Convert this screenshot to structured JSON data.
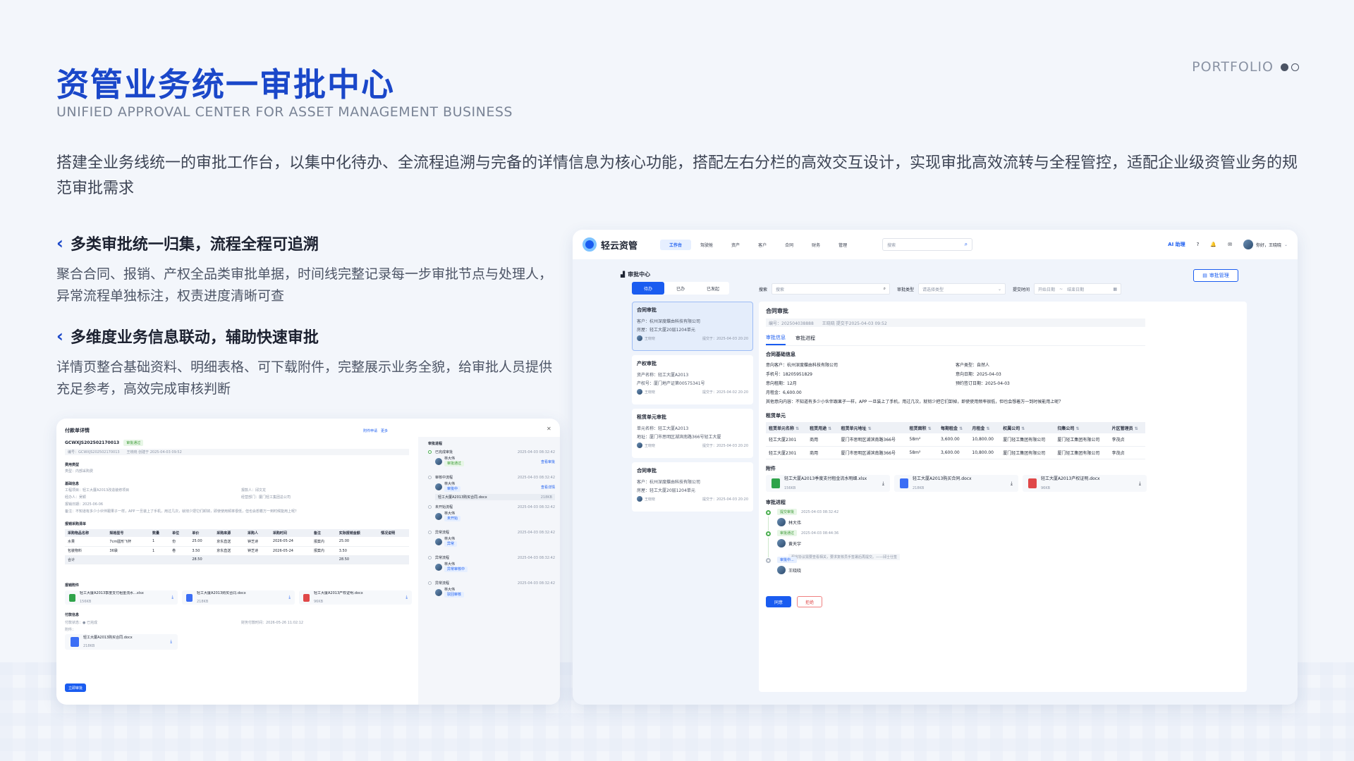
{
  "page": {
    "title": "资管业务统一审批中心",
    "subtitle": "UNIFIED APPROVAL CENTER FOR ASSET MANAGEMENT BUSINESS",
    "portfolio": "PORTFOLIO",
    "intro": "搭建全业务线统一的审批工作台，以集中化待办、全流程追溯与完备的详情信息为核心功能，搭配左右分栏的高效交互设计，实现审批高效流转与全程管控，适配企业级资管业务的规范审批需求"
  },
  "features": [
    {
      "heading": "多类审批统一归集，流程全程可追溯",
      "text": "聚合合同、报销、产权全品类审批单据，时间线完整记录每一步审批节点与处理人，异常流程单独标注，权责进度清晰可查"
    },
    {
      "heading": "多维度业务信息联动，辅助快速审批",
      "text": "详情页整合基础资料、明细表格、可下载附件，完整展示业务全貌，给审批人员提供充足参考，高效完成审核判断"
    }
  ],
  "app": {
    "brand": "轻云资管",
    "nav": [
      "工作台",
      "驾驶舱",
      "资产",
      "客户",
      "合同",
      "财务",
      "管理"
    ],
    "search_placeholder": "搜索",
    "assistant": "AI 助理",
    "user_greeting": "你好，王晓晓",
    "center_title": "审批中心",
    "manage_btn": "审批管理",
    "tabs": [
      "待办",
      "已办",
      "已发起"
    ],
    "filter": {
      "search_label": "搜索",
      "search_ph": "搜索",
      "type_label": "审批类型",
      "type_ph": "请选择类型",
      "time_label": "提交时间",
      "start_ph": "开始日期",
      "end_ph": "结束日期"
    },
    "list": [
      {
        "title": "合同审批",
        "l1": "客户：杭州深度蝶由科技有限公司",
        "l2": "房屋：轻工大厦20层1204单元",
        "user": "王晓晓",
        "time": "提交于：2025-04-03 20:20"
      },
      {
        "title": "产权审批",
        "l1": "资产名称：轻工大厦A2013",
        "l2": "产权号：厦门地产证第00575341号",
        "user": "王晓晓",
        "time": "提交于：2025-04-02 20:20"
      },
      {
        "title": "租赁单元审批",
        "l1": "单元名称：轻工大厦A2013",
        "l2": "地址：厦门市思明区湖滨南路366号轻工大厦",
        "user": "王晓晓",
        "time": "提交于：2025-04-03 20:20"
      },
      {
        "title": "合同审批",
        "l1": "客户：杭州深度蝶由科技有限公司",
        "l2": "房屋：轻工大厦20层1204单元",
        "user": "王晓晓",
        "time": "提交于：2025-04-03 20:20"
      }
    ],
    "detail": {
      "title": "合同审批",
      "meta": "编号：202504038888　　王晓晓 提交于2025-04-03 09:52",
      "tabs": [
        "审批信息",
        "审批进程"
      ],
      "basic_title": "合同基础信息",
      "basic": [
        [
          "意向客户：杭州深度蝶由科技有限公司",
          "客户类型：自然人"
        ],
        [
          "手机号：18205951829",
          "意向日期：2025-04-03"
        ],
        [
          "意向租期：12月",
          "预约签订日期：2025-04-03"
        ],
        [
          "月租金：6,600.00",
          ""
        ]
      ],
      "other": "其他意向内容：不知道有多少小伙伴跟果子一样，APP 一旦装上了手机，用过几次，就彻少把它们卸掉，即使使用频率很低，但也会想着万一到时候能用上呢？",
      "units_title": "租赁单元",
      "units_head": [
        "租赁单元名称",
        "租赁用途",
        "租赁单元地址",
        "租赁面积",
        "每期租金",
        "月租金",
        "权属公司",
        "归集公司",
        "片区管理员"
      ],
      "units_rows": [
        [
          "轻工大厦2301",
          "商用",
          "厦门市思明区湖滨南路366号",
          "58m²",
          "3,600.00",
          "10,800.00",
          "厦门轻工集团有限公司",
          "厦门轻工集团有限公司",
          "李茂贞"
        ],
        [
          "轻工大厦2301",
          "商用",
          "厦门市思明区湖滨南路366号",
          "58m²",
          "3,600.00",
          "10,800.00",
          "厦门轻工集团有限公司",
          "厦门轻工集团有限公司",
          "李茂贞"
        ]
      ],
      "attach_title": "附件",
      "attachments": [
        {
          "name": "轻工大厦A2013季度支付租金流水明细.xlsx",
          "size": "156KB"
        },
        {
          "name": "轻工大厦A2013购买合同.docx",
          "size": "218KB"
        },
        {
          "name": "轻工大厦A2013产权证明.docx",
          "size": "96KB"
        }
      ],
      "process_title": "审批进程",
      "process": [
        {
          "tag": "提交审批",
          "time": "2025-04-03 08:32:42",
          "user": "林大伟",
          "note": ""
        },
        {
          "tag": "审批通过",
          "time": "2025-04-03 08:44:36",
          "user": "黄天宇",
          "note": "租房协议需要查看相关，要求复核员手签署后再提交。——邱士仕签"
        },
        {
          "tag": "审批中...",
          "time": "",
          "user": "王晓晓",
          "note": ""
        }
      ],
      "approve": "同意",
      "reject": "拒绝"
    }
  },
  "small": {
    "title": "付款单详情",
    "status": "审批通过",
    "code": "GCWXJS202502170013",
    "meta": "编号：GCWXJS202502170013　　王晓晓 创建于 2025-04-03 09:52",
    "right_links": "附件申请　更多",
    "fee_title": "费用类型",
    "fee_text": "类型：内部采购费",
    "basic_title": "基础信息",
    "basic": [
      [
        "工程项目：轻工大厦A2013改造装修项目",
        "报款人：邱文龙"
      ],
      [
        "经办人：吴颖",
        "经营部门：厦门轻工集团总公司"
      ],
      [
        "报销日期：2025-06-06",
        ""
      ]
    ],
    "remark": "备注：不知道有多少小伙伴跟果子一样，APP 一旦装上了手机，用过几次，就彻少把它们卸掉，即使使用频率很低，但也会想着万一到时候能用上呢？",
    "table_title": "报销采购清单",
    "table_head": [
      "采购物品名称",
      "规格型号",
      "数量",
      "单位",
      "单价",
      "采购来源",
      "采购人",
      "采购时间",
      "备注",
      "实际报销金额",
      "情况说明"
    ],
    "table_rows": [
      [
        "水果",
        "7cm圆形飞杯",
        "1",
        "份",
        "25.00",
        "京东直送",
        "钟芝诗",
        "2026-05-24",
        "报案内",
        "25.00",
        ""
      ],
      [
        "包装物料",
        "36袋",
        "1",
        "卷",
        "3.50",
        "京东直送",
        "钟芝诗",
        "2026-05-24",
        "报案内",
        "3.50",
        ""
      ]
    ],
    "total": [
      "合计",
      "28.50",
      "28.50"
    ],
    "attach_title": "报销附件",
    "attachments": [
      {
        "name": "轻工大厦A2013季度支付租金流水...xlsx",
        "size": "156KB"
      },
      {
        "name": "轻工大厦A2013购买合同.docx",
        "size": "218KB"
      },
      {
        "name": "轻工大厦A2013产权证明.docx",
        "size": "96KB"
      }
    ],
    "pay_title": "付款信息",
    "pay_status": "付款状态：● 已完成",
    "pay_time": "财务付款时间：2026-05-26 11:02:12",
    "pay_attach_label": "附件：",
    "pay_attach": {
      "name": "轻工大厦A2013购买合同.docx",
      "size": "218KB"
    },
    "button": "立即审批",
    "process_title": "审批进程",
    "process": [
      {
        "label": "已完成审批",
        "time": "2025-04-03 08:32:42",
        "user": "林大伟",
        "tag": "审批通过",
        "link": "查看审批"
      },
      {
        "label": "审核中流程",
        "time": "2025-04-03 08:32:42",
        "user": "林大伟",
        "tag": "审批中",
        "link": "查看详情",
        "file": "轻工大厦A2013购买合同.docx",
        "fsize": "218KB"
      },
      {
        "label": "未开始流程",
        "time": "2025-04-03 08:32:42",
        "user": "林大伟",
        "tag": "未开始"
      },
      {
        "label": "异常流程",
        "time": "2025-04-03 08:32:42",
        "user": "林大伟",
        "tag": "异常"
      },
      {
        "label": "异常流程",
        "time": "2025-04-03 08:32:42",
        "user": "林大伟",
        "tag": "异常审核中"
      },
      {
        "label": "异常流程",
        "time": "2025-04-03 08:32:42",
        "user": "林大伟",
        "tag": "驳回审核"
      }
    ]
  }
}
